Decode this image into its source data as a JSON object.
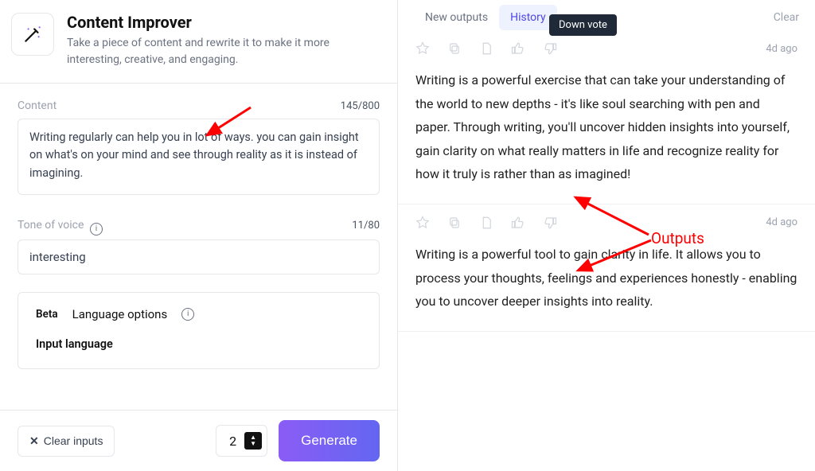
{
  "tool": {
    "title": "Content Improver",
    "subtitle": "Take a piece of content and rewrite it to make it more interesting, creative, and engaging."
  },
  "content_field": {
    "label": "Content",
    "counter": "145/800",
    "value": "Writing regularly can help you in lot of ways. you can gain insight on what's on your mind and see through reality as it is instead of imagining."
  },
  "tone_field": {
    "label": "Tone of voice",
    "counter": "11/80",
    "value": "interesting"
  },
  "lang": {
    "beta": "Beta",
    "options_label": "Language options",
    "input_label": "Input language"
  },
  "bottom": {
    "clear": "Clear inputs",
    "count": "2",
    "generate": "Generate"
  },
  "tabs": {
    "new": "New outputs",
    "history": "History",
    "clear": "Clear",
    "tooltip": "Down vote"
  },
  "outputs": [
    {
      "ago": "4d ago",
      "text": "Writing is a powerful exercise that can take your understanding of the world to new depths - it's like soul searching with pen and paper. Through writing, you'll uncover hidden insights into yourself, gain clarity on what really matters in life and recognize reality for how it truly is rather than as imagined!"
    },
    {
      "ago": "4d ago",
      "text": "Writing is a powerful tool to gain clarity in life. It allows you to process your thoughts, feelings and experiences honestly - enabling you to uncover deeper insights into reality."
    }
  ],
  "annotation": {
    "label": "Outputs"
  }
}
